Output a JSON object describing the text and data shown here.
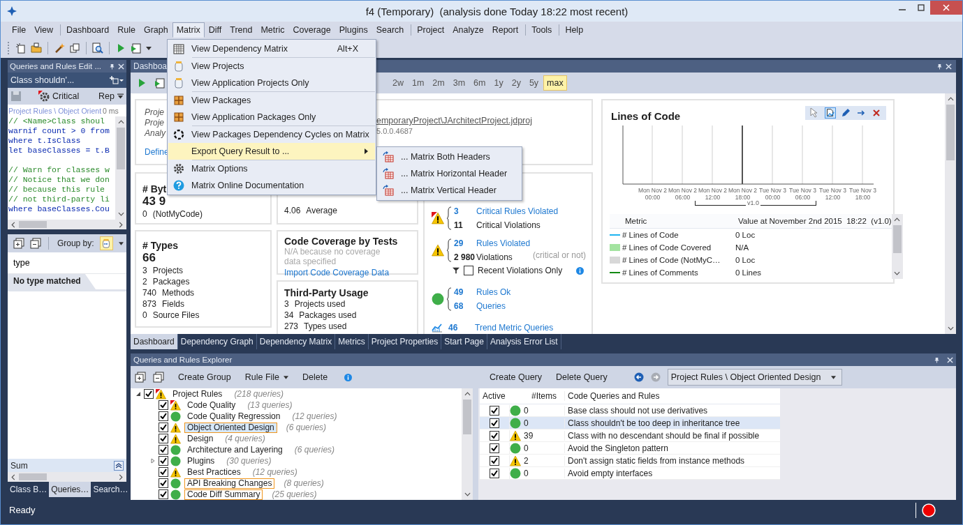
{
  "window": {
    "title": "f4 (Temporary)  (analysis done Today 18:22 most recent)"
  },
  "menu_bar": [
    {
      "label": "File",
      "separator_before": false,
      "selected": false
    },
    {
      "label": "View",
      "separator_before": false,
      "selected": false
    },
    {
      "label": "Dashboard",
      "separator_before": true,
      "selected": false
    },
    {
      "label": "Rule",
      "separator_before": false,
      "selected": false
    },
    {
      "label": "Graph",
      "separator_before": false,
      "selected": false
    },
    {
      "label": "Matrix",
      "separator_before": false,
      "selected": true
    },
    {
      "label": "Diff",
      "separator_before": false,
      "selected": false
    },
    {
      "label": "Trend",
      "separator_before": false,
      "selected": false
    },
    {
      "label": "Metric",
      "separator_before": false,
      "selected": false
    },
    {
      "label": "Coverage",
      "separator_before": false,
      "selected": false
    },
    {
      "label": "Plugins",
      "separator_before": false,
      "selected": false
    },
    {
      "label": "Search",
      "separator_before": false,
      "selected": false
    },
    {
      "label": "Project",
      "separator_before": true,
      "selected": false
    },
    {
      "label": "Analyze",
      "separator_before": false,
      "selected": false
    },
    {
      "label": "Report",
      "separator_before": false,
      "selected": false
    },
    {
      "label": "Tools",
      "separator_before": true,
      "selected": false
    },
    {
      "label": "Help",
      "separator_before": true,
      "selected": false
    }
  ],
  "open_menu": {
    "items": [
      {
        "label": "View Dependency Matrix",
        "shortcut": "Alt+X",
        "separator_before": false,
        "selected": false,
        "has_submenu": false
      },
      {
        "label": "View Projects",
        "separator_before": true,
        "selected": false,
        "has_submenu": false
      },
      {
        "label": "View Application Projects Only",
        "separator_before": false,
        "selected": false,
        "has_submenu": false
      },
      {
        "label": "View Packages",
        "separator_before": true,
        "selected": false,
        "has_submenu": false
      },
      {
        "label": "View Application Packages Only",
        "separator_before": false,
        "selected": false,
        "has_submenu": false
      },
      {
        "label": "View Packages Dependency Cycles on Matrix",
        "separator_before": true,
        "selected": false,
        "has_submenu": false
      },
      {
        "label": "Export Query Result to ...",
        "separator_before": false,
        "selected": true,
        "has_submenu": true
      },
      {
        "label": "Matrix Options",
        "separator_before": true,
        "selected": false,
        "has_submenu": false
      },
      {
        "label": "Matrix Online Documentation",
        "separator_before": false,
        "selected": false,
        "has_submenu": false
      }
    ],
    "submenu": [
      "... Matrix Both Headers",
      "... Matrix Horizontal Header",
      "... Matrix Vertical Header"
    ]
  },
  "left_panel": {
    "title": "Queries and Rules Edit ...",
    "query": "Class shouldn'...",
    "severity": "Critical",
    "report": "Rep",
    "path": "Project Rules \\ Object Orient",
    "duration": "0 ms",
    "code_lines": [
      {
        "kind": "comment",
        "text": "// <Name>Class shoul"
      },
      {
        "kind": "keyword",
        "text": "warnif count > 0 from"
      },
      {
        "kind": "keyword",
        "text": "where t.IsClass"
      },
      {
        "kind": "keyword",
        "text": "let baseClasses = t.B"
      },
      {
        "kind": "blank"
      },
      {
        "kind": "comment",
        "text": "// Warn for classes w"
      },
      {
        "kind": "comment",
        "text": "// Notice that we don"
      },
      {
        "kind": "comment",
        "text": "// because this rule"
      },
      {
        "kind": "comment",
        "text": "// not third-party li"
      },
      {
        "kind": "keyword",
        "text": "where baseClasses.Cou"
      }
    ]
  },
  "search_panel": {
    "group_by": "Group by:",
    "search_value": "type",
    "result": "No type matched",
    "footer": "Sum",
    "tabs": [
      {
        "label": "Class B…",
        "selected": false
      },
      {
        "label": "Queries…",
        "selected": true
      },
      {
        "label": "Search…",
        "selected": false
      }
    ]
  },
  "dashboard": {
    "tab": "Dashboa",
    "ranges": [
      {
        "label": "2w",
        "selected": false
      },
      {
        "label": "1m",
        "selected": false
      },
      {
        "label": "2m",
        "selected": false
      },
      {
        "label": "3m",
        "selected": false
      },
      {
        "label": "6m",
        "selected": false
      },
      {
        "label": "1y",
        "selected": false
      },
      {
        "label": "2y",
        "selected": false
      },
      {
        "label": "5y",
        "selected": false
      },
      {
        "label": "max",
        "selected": true
      }
    ],
    "project_card": {
      "labels": [
        "Proje",
        "Proje",
        "Analy"
      ],
      "file": "emporaryProject\\JArchitectProject.jdproj",
      "version": "5.0.0.4687",
      "link": "Define"
    },
    "bytes_card": {
      "title": "# Byt",
      "value": "43 9",
      "lines": [
        {
          "number": "0",
          "label": "(NotMyCode)"
        }
      ]
    },
    "types_card": {
      "title": "# Types",
      "value": "66",
      "lines": [
        {
          "number": "3",
          "label": "Projects"
        },
        {
          "number": "2",
          "label": "Packages"
        },
        {
          "number": "740",
          "label": "Methods"
        },
        {
          "number": "873",
          "label": "Fields"
        },
        {
          "number": "0",
          "label": "Source Files"
        }
      ]
    },
    "average": {
      "number": "4.06",
      "label": "Average"
    },
    "coverage_card": {
      "title": "Code Coverage by Tests",
      "note": "N/A because no coverage data specified",
      "link": "Import Code Coverage Data"
    },
    "third_party_card": {
      "title": "Third-Party Usage",
      "lines": [
        {
          "number": "3",
          "label": "Projects used"
        },
        {
          "number": "34",
          "label": "Packages used"
        },
        {
          "number": "273",
          "label": "Types used"
        }
      ]
    },
    "rules_card": {
      "groups": [
        {
          "kind": "critical",
          "rows": [
            {
              "number": "3",
              "label": "Critical Rules Violated",
              "link": true
            },
            {
              "number": "11",
              "label": "Critical Violations",
              "link": false
            }
          ]
        },
        {
          "kind": "warning",
          "note": "(critical or not)",
          "rows": [
            {
              "number": "29",
              "label": "Rules Violated",
              "link": true
            },
            {
              "number": "2 980",
              "label": "Violations",
              "link": false
            }
          ]
        },
        {
          "kind": "ok",
          "rows": [
            {
              "number": "49",
              "label": "Rules Ok",
              "link": true
            },
            {
              "number": "68",
              "label": "Queries",
              "link": true
            }
          ]
        }
      ],
      "filter": {
        "label": "Recent Violations Only",
        "checked": false
      },
      "trend": {
        "number": "46",
        "label": "Trend Metric Queries"
      }
    },
    "chart_card": {
      "title": "Lines of Code",
      "x_labels": [
        {
          "day": "Mon Nov 2",
          "time": "00:00"
        },
        {
          "day": "Mon Nov 2",
          "time": "06:00"
        },
        {
          "day": "Mon Nov 2",
          "time": "12:00"
        },
        {
          "day": "Mon Nov 2",
          "time": "18:00"
        },
        {
          "day": "Tue Nov 3",
          "time": "00:00"
        },
        {
          "day": "Tue Nov 3",
          "time": "06:00"
        },
        {
          "day": "Tue Nov 3",
          "time": "12:00"
        },
        {
          "day": "Tue Nov 3",
          "time": "18:00"
        }
      ],
      "version_label": "v1.0",
      "columns": [
        "Metric",
        "Value at November 2nd 2015  18:22  (v1.0)"
      ],
      "rows": [
        {
          "kind": "line",
          "color": "#1eb4f0",
          "metric": "# Lines of Code",
          "value": "0 Loc"
        },
        {
          "kind": "block",
          "color": "#a3e3a0",
          "metric": "# Lines of Code Covered",
          "value": "N/A"
        },
        {
          "kind": "block",
          "color": "#d8d8d8",
          "metric": "# Lines of Code (NotMyC…",
          "value": "0 Loc"
        },
        {
          "kind": "line",
          "color": "#138a13",
          "metric": "# Lines of Comments",
          "value": "0 Lines"
        }
      ]
    }
  },
  "document_tabs": [
    {
      "label": "Dashboard",
      "selected": true
    },
    {
      "label": "Dependency Graph",
      "selected": false
    },
    {
      "label": "Dependency Matrix",
      "selected": false
    },
    {
      "label": "Metrics",
      "selected": false
    },
    {
      "label": "Project Properties",
      "selected": false
    },
    {
      "label": "Start Page",
      "selected": false
    },
    {
      "label": "Analysis Error List",
      "selected": false
    }
  ],
  "explorer": {
    "title": "Queries and Rules Explorer",
    "toolbar": [
      {
        "label": "Create Group",
        "dropdown": false
      },
      {
        "label": "Rule File",
        "dropdown": true
      },
      {
        "label": "Delete",
        "dropdown": false
      }
    ],
    "tree": [
      {
        "label": "Project Rules",
        "count": "(218 queries)",
        "checked": true,
        "kind": "critical",
        "selected": false,
        "highlighted": false,
        "collapsed": false,
        "children": [
          {
            "label": "Code Quality",
            "count": "(13 queries)",
            "checked": true,
            "kind": "critical",
            "selected": false,
            "highlighted": false,
            "collapsed": false
          },
          {
            "label": "Code Quality Regression",
            "count": "(12 queries)",
            "checked": true,
            "kind": "ok",
            "selected": false,
            "highlighted": false,
            "collapsed": false
          },
          {
            "label": "Object Oriented Design",
            "count": "(6 queries)",
            "checked": true,
            "kind": "warning",
            "selected": true,
            "highlighted": true,
            "collapsed": false
          },
          {
            "label": "Design",
            "count": "(4 queries)",
            "checked": true,
            "kind": "warning",
            "selected": false,
            "highlighted": false,
            "collapsed": false
          },
          {
            "label": "Architecture and Layering",
            "count": "(6 queries)",
            "checked": true,
            "kind": "ok",
            "selected": false,
            "highlighted": false,
            "collapsed": false
          },
          {
            "label": "Plugins",
            "count": "(30 queries)",
            "checked": true,
            "kind": "ok",
            "selected": false,
            "highlighted": false,
            "collapsed": true
          },
          {
            "label": "Best Practices",
            "count": "(12 queries)",
            "checked": true,
            "kind": "warning",
            "selected": false,
            "highlighted": false,
            "collapsed": false
          },
          {
            "label": "API Breaking Changes",
            "count": "(8 queries)",
            "checked": true,
            "kind": "ok",
            "selected": false,
            "highlighted": true,
            "collapsed": false
          },
          {
            "label": "Code Diff Summary",
            "count": "(25 queries)",
            "checked": true,
            "kind": "ok",
            "selected": false,
            "highlighted": true,
            "collapsed": false
          }
        ]
      }
    ],
    "query_toolbar": [
      "Create Query",
      "Delete Query"
    ],
    "scope": "Project Rules \\ Object Oriented Design",
    "columns": [
      "Active",
      "#Items",
      "Code Queries and Rules"
    ],
    "rows": [
      {
        "checked": true,
        "kind": "ok",
        "items": "0",
        "name": "Base class should not use derivatives",
        "selected": false
      },
      {
        "checked": true,
        "kind": "ok",
        "items": "0",
        "name": "Class shouldn't be too deep in inheritance tree",
        "selected": true
      },
      {
        "checked": true,
        "kind": "warning",
        "items": "39",
        "name": "Class with no descendant should be final if possible",
        "selected": false
      },
      {
        "checked": true,
        "kind": "ok",
        "items": "0",
        "name": "Avoid the Singleton pattern",
        "selected": false
      },
      {
        "checked": true,
        "kind": "warning",
        "items": "2",
        "name": "Don't assign static fields from instance methods",
        "selected": false
      },
      {
        "checked": true,
        "kind": "ok",
        "items": "0",
        "name": "Avoid empty interfaces",
        "selected": false
      }
    ]
  },
  "status_bar": {
    "text": "Ready"
  }
}
